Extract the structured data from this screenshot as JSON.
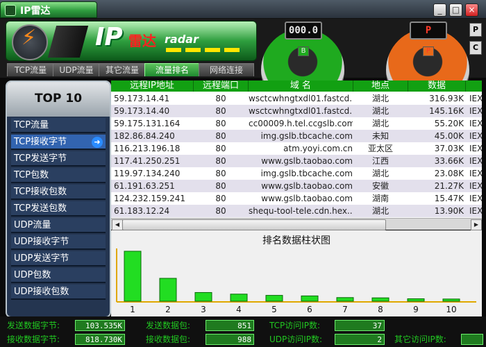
{
  "window": {
    "title": "IP雷达",
    "min": "_",
    "max": "□",
    "close": "×"
  },
  "banner": {
    "ip": "IP",
    "cn": "雷达",
    "en": "radar"
  },
  "tabs": [
    {
      "label": "TCP流量",
      "active": false
    },
    {
      "label": "UDP流量",
      "active": false
    },
    {
      "label": "其它流量",
      "active": false
    },
    {
      "label": "流量排名",
      "active": true
    },
    {
      "label": "网络连接",
      "active": false
    }
  ],
  "gauges": [
    {
      "digits": "000.0",
      "badge": "B",
      "color": "#1faa1f",
      "digit_color": "#e9e9e9"
    },
    {
      "digits": "P",
      "badge": "P",
      "color": "#e8691a",
      "digit_color": "#ff3b2a"
    }
  ],
  "side_buttons": [
    "P",
    "C"
  ],
  "left_panel": {
    "title": "TOP 10",
    "items": [
      {
        "label": "TCP流量",
        "active": false
      },
      {
        "label": "TCP接收字节",
        "active": true
      },
      {
        "label": "TCP发送字节",
        "active": false
      },
      {
        "label": "TCP包数",
        "active": false
      },
      {
        "label": "TCP接收包数",
        "active": false
      },
      {
        "label": "TCP发送包数",
        "active": false
      },
      {
        "label": "UDP流量",
        "active": false
      },
      {
        "label": "UDP接收字节",
        "active": false
      },
      {
        "label": "UDP发送字节",
        "active": false
      },
      {
        "label": "UDP包数",
        "active": false
      },
      {
        "label": "UDP接收包数",
        "active": false
      }
    ]
  },
  "table": {
    "columns": [
      "远程IP地址",
      "远程端口",
      "域 名",
      "地点",
      "数据",
      ""
    ],
    "rows": [
      [
        "59.173.14.41",
        "80",
        "wsctcwhngtxdl01.fastcd...",
        "湖北",
        "316.93K",
        "IEX"
      ],
      [
        "59.173.14.40",
        "80",
        "wsctcwhngtxdl01.fastcd...",
        "湖北",
        "145.16K",
        "IEX"
      ],
      [
        "59.175.131.164",
        "80",
        "cc00009.h.tel.ccgslb.com",
        "湖北",
        "55.20K",
        "IEX"
      ],
      [
        "182.86.84.240",
        "80",
        "img.gslb.tbcache.com",
        "未知",
        "45.00K",
        "IEX"
      ],
      [
        "116.213.196.18",
        "80",
        "atm.yoyi.com.cn",
        "亚太区",
        "37.03K",
        "IEX"
      ],
      [
        "117.41.250.251",
        "80",
        "www.gslb.taobao.com",
        "江西",
        "33.66K",
        "IEX"
      ],
      [
        "119.97.134.240",
        "80",
        "img.gslb.tbcache.com",
        "湖北",
        "23.08K",
        "IEX"
      ],
      [
        "61.191.63.251",
        "80",
        "www.gslb.taobao.com",
        "安徽",
        "21.27K",
        "IEX"
      ],
      [
        "124.232.159.241",
        "80",
        "www.gslb.taobao.com",
        "湖南",
        "15.47K",
        "IEX"
      ],
      [
        "61.183.12.24",
        "80",
        "shequ-tool-tele.cdn.hex...",
        "湖北",
        "13.90K",
        "IEX"
      ]
    ]
  },
  "chart_data": {
    "type": "bar",
    "title": "排名数据柱状图",
    "categories": [
      "1",
      "2",
      "3",
      "4",
      "5",
      "6",
      "7",
      "8",
      "9",
      "10"
    ],
    "values": [
      316.93,
      145.16,
      55.2,
      45.0,
      37.03,
      33.66,
      23.08,
      21.27,
      15.47,
      13.9
    ],
    "bar_color": "#22dd22",
    "axis_color": "#e0a800"
  },
  "status": {
    "send_bytes_label": "发送数据字节:",
    "send_bytes_value": "103.535K",
    "send_packets_label": "发送数据包:",
    "send_packets_value": "851",
    "tcp_ip_label": "TCP访问IP数:",
    "tcp_ip_value": "37",
    "recv_bytes_label": "接收数据字节:",
    "recv_bytes_value": "818.730K",
    "recv_packets_label": "接收数据包:",
    "recv_packets_value": "988",
    "udp_ip_label": "UDP访问IP数:",
    "udp_ip_value": "2",
    "other_ip_label": "其它访问IP数:",
    "other_ip_value": ""
  }
}
